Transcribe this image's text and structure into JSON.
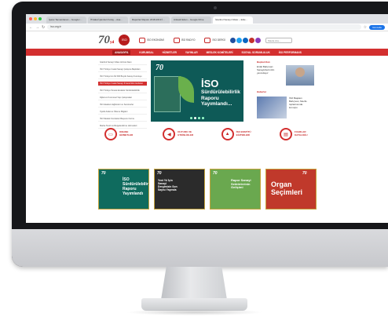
{
  "browser": {
    "tabs": [
      {
        "label": "İşaret Tamamlanan – Google i…"
      },
      {
        "label": "İTHalat İşlemleri Kolay – Asa…"
      },
      {
        "label": "Raporlar Raporu 2018-2019 İ…"
      },
      {
        "label": "Ankastl Eden – Google Drive"
      },
      {
        "label": "İstanbul Sanayi Odası – Ekle…"
      }
    ],
    "address": "iso.org.tr",
    "update_label": "Güncelle"
  },
  "site": {
    "logo_text": "70",
    "logo_sub": "yıl",
    "iso_badge": "İSO",
    "header_links": [
      "İSO EKONOMİ",
      "İSO RADYO",
      "İSO DERGİ"
    ],
    "search_placeholder": "Sitede Ara..."
  },
  "nav": {
    "items": [
      "ANASAYFA",
      "KURUMSAL",
      "HİZMETLER",
      "YAYINLAR",
      "MESLEK KOMİTELERİ",
      "SOSYAL SORUMLULUK",
      "İSO PERFORMANS"
    ]
  },
  "left_menu": {
    "items": [
      "İstanbul Sanayi Odası Hizmet Alanı",
      "İSO Türkiye İmalat Sanayi Çalışma Başlıkları",
      "İSO Türkiye'nin İlk 500 Büyük Sanayi Kuruluşu",
      "İSO Türkiye İmalat Sanayi İhracat İklim Endeksi",
      "İSO Türkiye İhracat Endeksi Sürdürülebilirlik",
      "Dijital ve Kurumsal Yapı Çalışmaları",
      "İSO Akademi Eğitimleri ve Seminerler",
      "Üyelik Aidat ve Ödeme Bilgileri",
      "İSO Meslek Komiteleri Başvuru Formu",
      "Marka Tescil ve Belgelendirme Hizmetleri"
    ],
    "highlighted_index": 3
  },
  "hero": {
    "badge": "70",
    "title": "İSO",
    "subtitle": "Sürdürülebilirlik Raporu Yayımlandı..."
  },
  "right_column": {
    "section_title": "Başkan'dan",
    "person_text": "Erdal Bahçıvan: Sanayicilerimizin yanındayız",
    "news_title": "Haberler",
    "news_text": "İSO Başkanı Bahçıvan, Meclis toplantısında konuştu"
  },
  "icon_row": [
    {
      "icon": "laptop-icon",
      "label": "ONLINE HİZMETLER"
    },
    {
      "icon": "megaphone-icon",
      "label": "DUYURU VE ETKİNLİKLER"
    },
    {
      "icon": "education-icon",
      "label": "İSO ENSTİTÜ EĞİTİMLERİ"
    },
    {
      "icon": "document-icon",
      "label": "FUARLAR KATALOĞU"
    }
  ],
  "cards": [
    {
      "badge": "70",
      "title": "İSO Sürdürülebilirlik Raporu Yayımlandı"
    },
    {
      "badge": "70",
      "title": "Yeni Yıl İçin Sanayi Dergimizin Son Sayısı Yayında"
    },
    {
      "badge": "70",
      "title": "Rapor Sanayi Sektörlerinin Gelişimi"
    },
    {
      "badge": "70",
      "title": "Organ Seçimleri"
    }
  ],
  "colors": {
    "accent": "#d32f2f",
    "hero_bg": "#0e5a57",
    "card2_bg": "#2b2b2b",
    "card3_bg": "#6aa84f",
    "card4_bg": "#c0392b"
  }
}
